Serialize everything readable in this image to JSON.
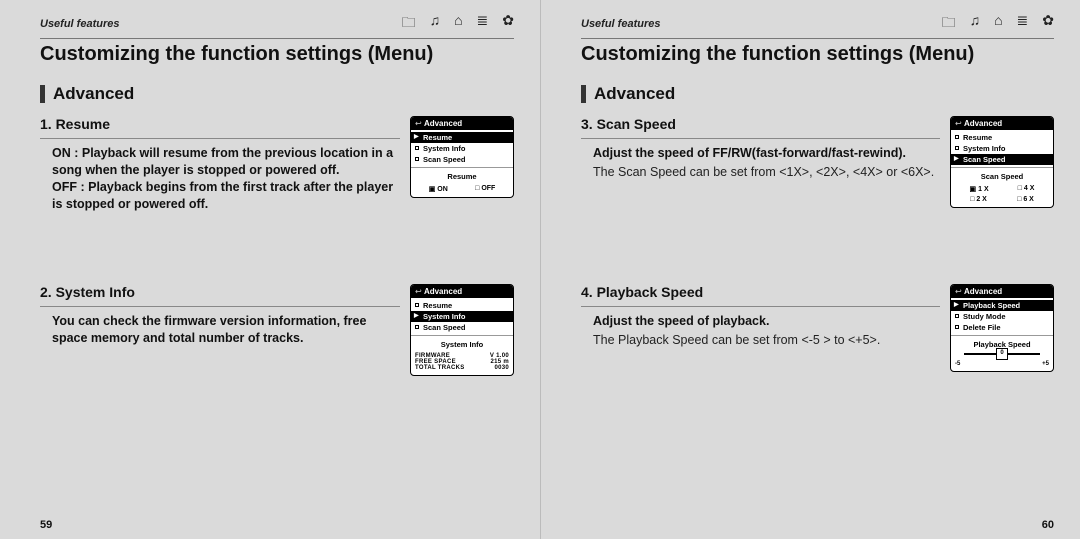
{
  "header": {
    "useful": "Useful features",
    "title": "Customizing the function settings (Menu)",
    "section": "Advanced"
  },
  "icons": [
    "folder",
    "note",
    "home",
    "list",
    "gear"
  ],
  "pages": {
    "left_num": "59",
    "right_num": "60"
  },
  "items": [
    {
      "num": "1. Resume",
      "body_on_label": "ON :",
      "body_on_text": "Playback will resume from the previous location in a song when the player is stopped or powered off.",
      "body_off_label": "OFF :",
      "body_off_text": "Playback begins from the first track after the player is stopped or powered off.",
      "screen_title": "Advanced",
      "screen_items": [
        "Resume",
        "System Info",
        "Scan Speed"
      ],
      "screen_selected": 0,
      "panel_title": "Resume",
      "toggle": {
        "on": "ON",
        "off": "OFF",
        "selected": "ON"
      }
    },
    {
      "num": "2. System Info",
      "desc": "You can check the firmware version information, free space memory and total number of tracks.",
      "screen_title": "Advanced",
      "screen_items": [
        "Resume",
        "System Info",
        "Scan Speed"
      ],
      "screen_selected": 1,
      "panel_title": "System Info",
      "kv": [
        {
          "k": "FIRMWARE",
          "v": "V 1.00"
        },
        {
          "k": "FREE SPACE",
          "v": "215 m"
        },
        {
          "k": "TOTAL TRACKS",
          "v": "0030"
        }
      ]
    },
    {
      "num": "3. Scan Speed",
      "desc_bold": "Adjust the speed of FF/RW(fast-forward/fast-rewind).",
      "desc": "The Scan Speed can be set from <1X>, <2X>, <4X> or <6X>.",
      "screen_title": "Advanced",
      "screen_items": [
        "Resume",
        "System Info",
        "Scan Speed"
      ],
      "screen_selected": 2,
      "panel_title": "Scan Speed",
      "grid": [
        [
          "1 X",
          "4 X"
        ],
        [
          "2 X",
          "6 X"
        ]
      ],
      "grid_selected": "1 X"
    },
    {
      "num": "4. Playback Speed",
      "desc_bold": "Adjust the speed of playback.",
      "desc": "The Playback Speed can be set from <-5 > to <+5>.",
      "screen_title": "Advanced",
      "screen_items": [
        "Playback Speed",
        "Study Mode",
        "Delete File"
      ],
      "screen_selected": 0,
      "panel_title": "Playback Speed",
      "slider": {
        "min": "-5",
        "center": "0",
        "max": "+5"
      }
    }
  ]
}
